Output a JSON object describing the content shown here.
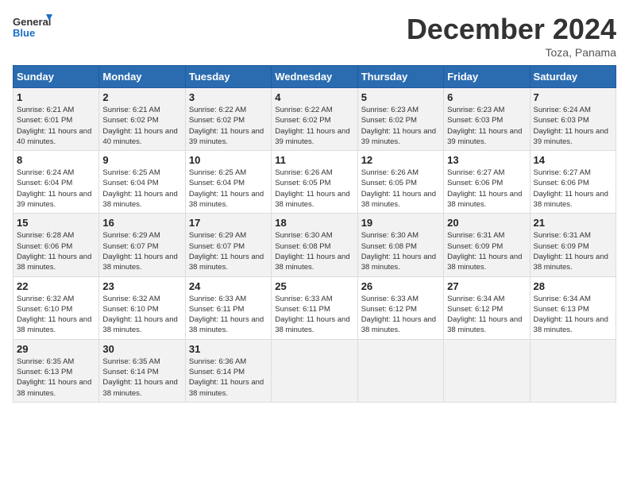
{
  "logo": {
    "line1": "General",
    "line2": "Blue"
  },
  "title": "December 2024",
  "subtitle": "Toza, Panama",
  "headers": [
    "Sunday",
    "Monday",
    "Tuesday",
    "Wednesday",
    "Thursday",
    "Friday",
    "Saturday"
  ],
  "weeks": [
    [
      {
        "day": "1",
        "sunrise": "6:21 AM",
        "sunset": "6:01 PM",
        "daylight": "11 hours and 40 minutes."
      },
      {
        "day": "2",
        "sunrise": "6:21 AM",
        "sunset": "6:02 PM",
        "daylight": "11 hours and 40 minutes."
      },
      {
        "day": "3",
        "sunrise": "6:22 AM",
        "sunset": "6:02 PM",
        "daylight": "11 hours and 39 minutes."
      },
      {
        "day": "4",
        "sunrise": "6:22 AM",
        "sunset": "6:02 PM",
        "daylight": "11 hours and 39 minutes."
      },
      {
        "day": "5",
        "sunrise": "6:23 AM",
        "sunset": "6:02 PM",
        "daylight": "11 hours and 39 minutes."
      },
      {
        "day": "6",
        "sunrise": "6:23 AM",
        "sunset": "6:03 PM",
        "daylight": "11 hours and 39 minutes."
      },
      {
        "day": "7",
        "sunrise": "6:24 AM",
        "sunset": "6:03 PM",
        "daylight": "11 hours and 39 minutes."
      }
    ],
    [
      {
        "day": "8",
        "sunrise": "6:24 AM",
        "sunset": "6:04 PM",
        "daylight": "11 hours and 39 minutes."
      },
      {
        "day": "9",
        "sunrise": "6:25 AM",
        "sunset": "6:04 PM",
        "daylight": "11 hours and 38 minutes."
      },
      {
        "day": "10",
        "sunrise": "6:25 AM",
        "sunset": "6:04 PM",
        "daylight": "11 hours and 38 minutes."
      },
      {
        "day": "11",
        "sunrise": "6:26 AM",
        "sunset": "6:05 PM",
        "daylight": "11 hours and 38 minutes."
      },
      {
        "day": "12",
        "sunrise": "6:26 AM",
        "sunset": "6:05 PM",
        "daylight": "11 hours and 38 minutes."
      },
      {
        "day": "13",
        "sunrise": "6:27 AM",
        "sunset": "6:06 PM",
        "daylight": "11 hours and 38 minutes."
      },
      {
        "day": "14",
        "sunrise": "6:27 AM",
        "sunset": "6:06 PM",
        "daylight": "11 hours and 38 minutes."
      }
    ],
    [
      {
        "day": "15",
        "sunrise": "6:28 AM",
        "sunset": "6:06 PM",
        "daylight": "11 hours and 38 minutes."
      },
      {
        "day": "16",
        "sunrise": "6:29 AM",
        "sunset": "6:07 PM",
        "daylight": "11 hours and 38 minutes."
      },
      {
        "day": "17",
        "sunrise": "6:29 AM",
        "sunset": "6:07 PM",
        "daylight": "11 hours and 38 minutes."
      },
      {
        "day": "18",
        "sunrise": "6:30 AM",
        "sunset": "6:08 PM",
        "daylight": "11 hours and 38 minutes."
      },
      {
        "day": "19",
        "sunrise": "6:30 AM",
        "sunset": "6:08 PM",
        "daylight": "11 hours and 38 minutes."
      },
      {
        "day": "20",
        "sunrise": "6:31 AM",
        "sunset": "6:09 PM",
        "daylight": "11 hours and 38 minutes."
      },
      {
        "day": "21",
        "sunrise": "6:31 AM",
        "sunset": "6:09 PM",
        "daylight": "11 hours and 38 minutes."
      }
    ],
    [
      {
        "day": "22",
        "sunrise": "6:32 AM",
        "sunset": "6:10 PM",
        "daylight": "11 hours and 38 minutes."
      },
      {
        "day": "23",
        "sunrise": "6:32 AM",
        "sunset": "6:10 PM",
        "daylight": "11 hours and 38 minutes."
      },
      {
        "day": "24",
        "sunrise": "6:33 AM",
        "sunset": "6:11 PM",
        "daylight": "11 hours and 38 minutes."
      },
      {
        "day": "25",
        "sunrise": "6:33 AM",
        "sunset": "6:11 PM",
        "daylight": "11 hours and 38 minutes."
      },
      {
        "day": "26",
        "sunrise": "6:33 AM",
        "sunset": "6:12 PM",
        "daylight": "11 hours and 38 minutes."
      },
      {
        "day": "27",
        "sunrise": "6:34 AM",
        "sunset": "6:12 PM",
        "daylight": "11 hours and 38 minutes."
      },
      {
        "day": "28",
        "sunrise": "6:34 AM",
        "sunset": "6:13 PM",
        "daylight": "11 hours and 38 minutes."
      }
    ],
    [
      {
        "day": "29",
        "sunrise": "6:35 AM",
        "sunset": "6:13 PM",
        "daylight": "11 hours and 38 minutes."
      },
      {
        "day": "30",
        "sunrise": "6:35 AM",
        "sunset": "6:14 PM",
        "daylight": "11 hours and 38 minutes."
      },
      {
        "day": "31",
        "sunrise": "6:36 AM",
        "sunset": "6:14 PM",
        "daylight": "11 hours and 38 minutes."
      },
      null,
      null,
      null,
      null
    ]
  ]
}
